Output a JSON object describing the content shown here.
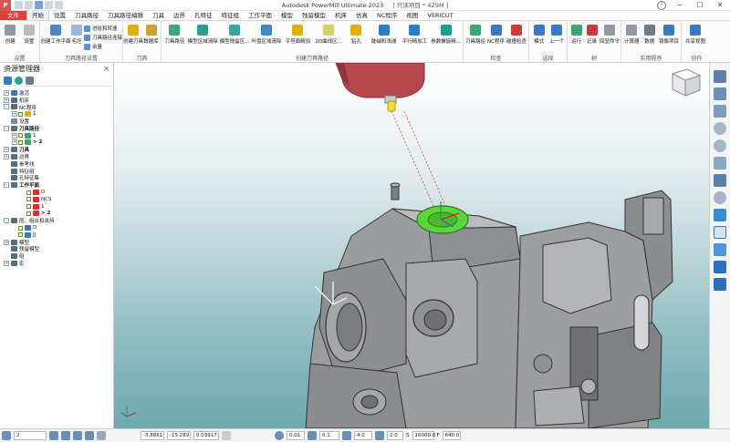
{
  "window": {
    "title": "Autodesk PowerMill Ultimate 2023",
    "project": "[ 只读项目 * 4Z9M ]",
    "logo": "P",
    "help": "?",
    "minimize": "─",
    "maximize": "☐",
    "close": "✕"
  },
  "menu": {
    "file": "文件",
    "tabs": [
      "开始",
      "设置",
      "刀具路径",
      "刀具路径编辑",
      "刀具",
      "边界",
      "孔特征",
      "特征组",
      "工作平面",
      "模型",
      "残留模型",
      "机床",
      "仿真",
      "NC程序",
      "视图",
      "VERICUT"
    ],
    "active_index": 0
  },
  "ribbon": {
    "groups": {
      "setup": "设置",
      "toolpath_setup": "刀具路径设置",
      "tool": "刀具",
      "create_toolpath": "创建刀具路径",
      "check": "检查",
      "select": "选择",
      "tree": "树",
      "utilities": "实用程序",
      "collab": "协作"
    },
    "buttons": {
      "create": "创建",
      "settings": "设置",
      "create_wp": "创建工作平面",
      "feed": "毛坯",
      "approach": "进给和转速",
      "tp_connect": "刀具路径连接",
      "allowance": "余量",
      "create_tool": "创建刀具",
      "database": "数据库",
      "toolpath": "刀具路径",
      "model_area": "模型区域清除",
      "model_rest": "模型残留区...",
      "blade_area": "叶盘区域清除",
      "flat_finish": "平坦面精加",
      "z_area": "2D曲线区...",
      "drill": "钻孔",
      "steep_shallow": "陡峭和浅滩",
      "parallel": "平行精加工",
      "param_spiral": "参数螺旋精...",
      "tp_check": "刀具路径",
      "nc_check": "NC程序",
      "collision": "碰撞检查",
      "mode": "模式",
      "previous": "上一个",
      "run": "运行",
      "record": "记录",
      "echo": "回显命令",
      "calculator": "计算器",
      "db2": "数据",
      "images": "镜像项目",
      "share": "共享视图"
    }
  },
  "explorer": {
    "title": "资源管理器",
    "close": "✕",
    "nodes": [
      {
        "label": "激活",
        "level": 0,
        "exp": "+",
        "bold": false,
        "color": "#3b78c4"
      },
      {
        "label": "机床",
        "level": 0,
        "exp": "+",
        "bold": false,
        "color": "#5a6b7a"
      },
      {
        "label": "NC程序",
        "level": 0,
        "exp": "-",
        "bold": false,
        "color": "#5a6b7a"
      },
      {
        "label": "1",
        "level": 1,
        "exp": "+",
        "bold": false,
        "color": "#e0b100"
      },
      {
        "label": "设置",
        "level": 0,
        "exp": "",
        "bold": false,
        "color": "#7b8a99"
      },
      {
        "label": "刀具路径",
        "level": 0,
        "exp": "-",
        "bold": true,
        "color": "#5a6b7a"
      },
      {
        "label": "1",
        "level": 1,
        "exp": "+",
        "bold": false,
        "color": "#2eaa6b"
      },
      {
        "label": "> 2",
        "level": 1,
        "exp": "+",
        "bold": true,
        "color": "#2eaa6b"
      },
      {
        "label": "刀具",
        "level": 0,
        "exp": "+",
        "bold": true,
        "color": "#5a6b7a"
      },
      {
        "label": "边界",
        "level": 0,
        "exp": "+",
        "bold": false,
        "color": "#5a6b7a"
      },
      {
        "label": "参考线",
        "level": 0,
        "exp": "",
        "bold": false,
        "color": "#5a6b7a"
      },
      {
        "label": "特征组",
        "level": 0,
        "exp": "",
        "bold": false,
        "color": "#5a6b7a"
      },
      {
        "label": "孔特征集",
        "level": 0,
        "exp": "",
        "bold": false,
        "color": "#5a6b7a"
      },
      {
        "label": "工作平面",
        "level": 0,
        "exp": "-",
        "bold": true,
        "color": "#5a6b7a"
      },
      {
        "label": "D",
        "level": 2,
        "exp": "",
        "bold": false,
        "color": "#c33"
      },
      {
        "label": "NCS",
        "level": 2,
        "exp": "",
        "bold": false,
        "color": "#c33"
      },
      {
        "label": "1",
        "level": 2,
        "exp": "",
        "bold": false,
        "color": "#c33"
      },
      {
        "label": "> 2",
        "level": 2,
        "exp": "",
        "bold": true,
        "color": "#c33"
      },
      {
        "label": "层、组合和夹持",
        "level": 0,
        "exp": "-",
        "bold": false,
        "color": "#5a6b7a"
      },
      {
        "label": "D",
        "level": 1,
        "exp": "",
        "bold": false,
        "color": "#3b78c4"
      },
      {
        "label": "JJ",
        "level": 1,
        "exp": "",
        "bold": false,
        "color": "#3b78c4"
      },
      {
        "label": "模型",
        "level": 0,
        "exp": "+",
        "bold": false,
        "color": "#5a6b7a"
      },
      {
        "label": "残留模型",
        "level": 0,
        "exp": "",
        "bold": false,
        "color": "#5a6b7a"
      },
      {
        "label": "组",
        "level": 0,
        "exp": "",
        "bold": false,
        "color": "#5a6b7a"
      },
      {
        "label": "宏",
        "level": 0,
        "exp": "+",
        "bold": false,
        "color": "#5a6b7a"
      }
    ]
  },
  "statusbar": {
    "workplane": "2",
    "x": "-3.8861",
    "y": "-15.289",
    "z": "0.03917",
    "tol": "0.01",
    "step": "0.1",
    "stepdown": "4.0",
    "diam": "2.0",
    "speed_label": "S",
    "speed": "16000.0",
    "feed_label": "F",
    "feed": "640.0"
  }
}
